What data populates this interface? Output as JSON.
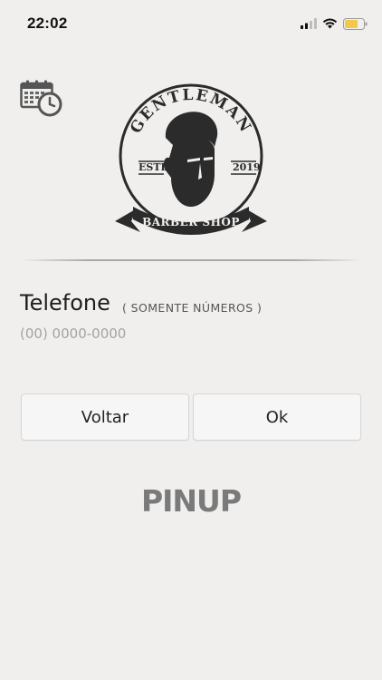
{
  "status_bar": {
    "time": "22:02",
    "icons": [
      "signal-icon",
      "wifi-icon",
      "battery-icon"
    ],
    "battery_color": "#f2c94c"
  },
  "header": {
    "calendar_icon": "calendar-clock-icon",
    "logo": {
      "top_text": "GENTLEMAN",
      "left_text": "ESTD",
      "right_text": "2019",
      "ribbon_text": "BARBER SHOP"
    }
  },
  "form": {
    "phone_label": "Telefone",
    "phone_hint": "( SOMENTE NÚMEROS )",
    "phone_placeholder": "(00) 0000-0000",
    "phone_value": ""
  },
  "actions": {
    "back_label": "Voltar",
    "ok_label": "Ok"
  },
  "footer": {
    "brand": "PINUP"
  },
  "colors": {
    "background": "#f0efee",
    "button_bg": "#f6f6f6",
    "brand_gray": "#7a7a7a",
    "logo_dark": "#2b2b2b"
  }
}
